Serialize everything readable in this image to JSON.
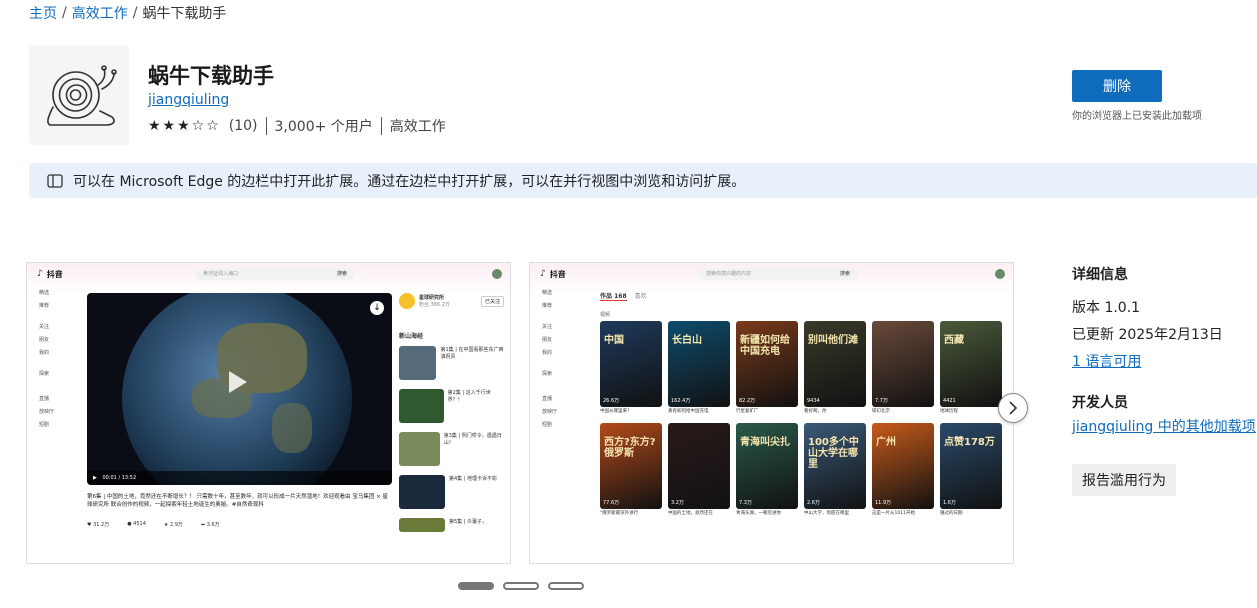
{
  "breadcrumb": {
    "home": "主页",
    "category": "高效工作",
    "current": "蜗牛下载助手"
  },
  "extension": {
    "title": "蜗牛下载助手",
    "author": "jiangqiuling",
    "stars": "★★★☆☆",
    "rating_count": "(10)",
    "users": "3,000+ 个用户",
    "category": "高效工作",
    "remove_label": "删除",
    "installed_note": "你的浏览器上已安装此加载项"
  },
  "banner": {
    "text": "可以在 Microsoft Edge 的边栏中打开此扩展。通过在边栏中打开扩展，可以在并行视图中浏览和访问扩展。"
  },
  "details": {
    "heading": "详细信息",
    "version": "版本 1.0.1",
    "updated": "已更新 2025年2月13日",
    "languages": "1 语言可用",
    "developer_heading": "开发人员",
    "developer_link": "jiangqiuling 中的其他加载项",
    "report_label": "报告滥用行为"
  },
  "screenshot1": {
    "logo": "抖音",
    "search_placeholder": "黄河证词入海口",
    "search_btn": "搜索",
    "side": [
      "精选",
      "推荐",
      "关注",
      "朋友",
      "我的",
      "探索",
      "直播",
      "放映厅",
      "短剧"
    ],
    "channel_name": "星球研究所",
    "channel_stats": "粉丝 386.2万",
    "follow": "已关注",
    "playlist_title": "新山海经",
    "desc": "第6集 | 中国的土地，竟然还在不断增长？！ 只需数十年，甚至数年，就可以形成一片天然湿地！欢迎观看由 宝马集团 × 星球研究所 联合创作的视频，一起探索年轻土地诞生的奥秘。#自然奇观科",
    "time": "00:01 / 13:52",
    "likes": "31.2万",
    "comments": "4514",
    "favs": "2.9万",
    "shares": "3.6万",
    "ep": [
      "第1集 | 在中国看那些东广西滇祝贵",
      "第2集 | 这入千行世界？！",
      "第3集 | 例门哎令，遇遇日山！",
      "第4集 | 地理卡诉不彰",
      "第5集 | 炎薯子，"
    ]
  },
  "screenshot2": {
    "logo": "抖音",
    "search_placeholder": "搜索你感兴趣的内容",
    "search_btn": "搜索",
    "tab_works": "作品 168",
    "tab_likes": "喜欢",
    "section": "视频",
    "cards": [
      {
        "text": "中国",
        "color": "#1e3a5c"
      },
      {
        "text": "长白山",
        "color": "#0e4c6e"
      },
      {
        "text": "新疆如何给中国充电",
        "color": "#7a3a1a"
      },
      {
        "text": "别叫他们滩",
        "color": "#3a3a2a"
      },
      {
        "text": "",
        "color": "#6a4a3a"
      },
      {
        "text": "西藏",
        "color": "#4a5a3a"
      },
      {
        "text": "西方?东方?俄罗斯",
        "color": "#b34a1a"
      },
      {
        "text": "",
        "color": "#2a1a1a"
      },
      {
        "text": "青海叫尖扎",
        "color": "#2a5a4a"
      },
      {
        "text": "100多个中山大学在哪里",
        "color": "#3a5a7a"
      },
      {
        "text": "广州",
        "color": "#c85a1a"
      },
      {
        "text": "点赞178万",
        "color": "#2a4a6a"
      }
    ],
    "captions": [
      "中国从哪里来?",
      "真有如何给中国充电",
      "行星复矿厂",
      "看好啊，你",
      "碳幻北京",
      "地球历程",
      "\"俄罗斯最深外进行",
      "中国的土地，竟然还在",
      "青海东湖，一朝见进你",
      "中山大学，到底在哪里",
      "这是一片从1011开始",
      "难过的日期"
    ],
    "counts": [
      "26.6万",
      "162.4万",
      "82.2万",
      "9434",
      "7.7万",
      "4421",
      "77.6万",
      "3.2万",
      "7.3万",
      "2.6万",
      "11.9万",
      "1.6万"
    ]
  }
}
